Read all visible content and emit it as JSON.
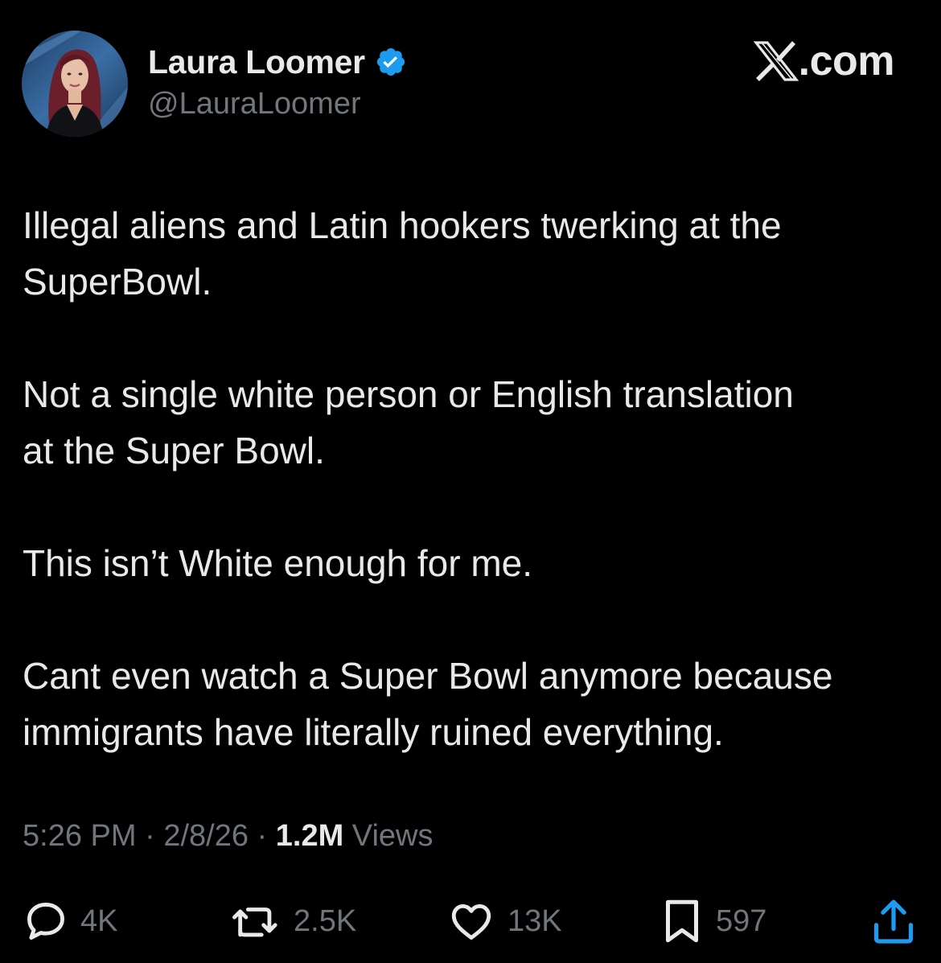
{
  "author": {
    "display_name": "Laura Loomer",
    "handle": "@LauraLoomer",
    "verified": true,
    "avatar_icon": "profile-photo"
  },
  "brand": {
    "logo_icon": "x-logo-icon",
    "text": ".com"
  },
  "tweet": {
    "paragraphs": [
      "Illegal aliens and Latin hookers twerking at the\nSuperBowl.",
      "Not a single white person or English translation\nat the Super Bowl.",
      "This isn’t White enough for me.",
      "Cant even watch a Super Bowl anymore because\nimmigrants have literally ruined everything."
    ]
  },
  "meta": {
    "time": "5:26 PM",
    "separator": "·",
    "date": "2/8/26",
    "views_count": "1.2M",
    "views_label": "Views"
  },
  "actions": {
    "replies": "4K",
    "reposts": "2.5K",
    "likes": "13K",
    "bookmarks": "597"
  },
  "colors": {
    "background": "#000000",
    "primary_text": "#e7e9ea",
    "secondary_text": "#71767b",
    "verified_blue": "#1d9bf0"
  }
}
